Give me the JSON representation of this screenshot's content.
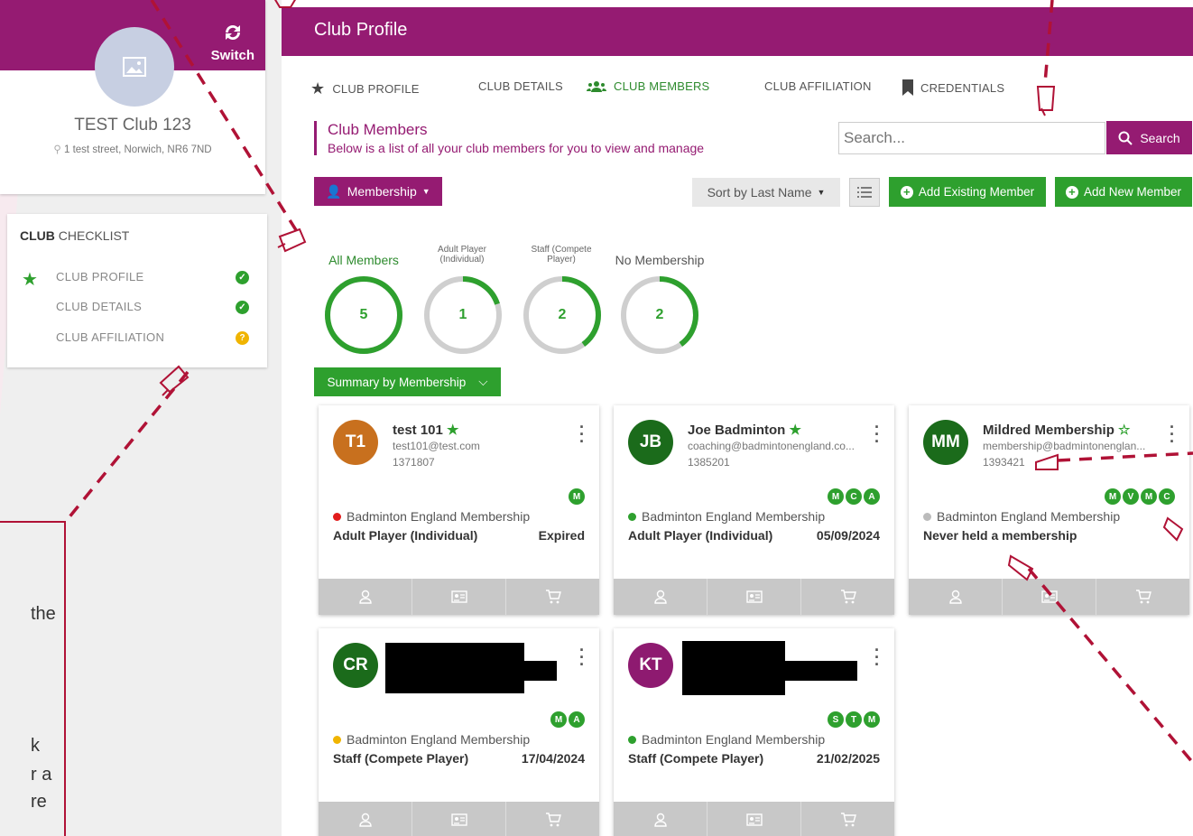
{
  "sidebar": {
    "switch_label": "Switch",
    "club_name": "TEST Club 123",
    "club_address": "1 test street, Norwich, NR6 7ND",
    "checklist_title_bold": "CLUB",
    "checklist_title_rest": "CHECKLIST",
    "checklist_items": [
      {
        "label": "CLUB PROFILE",
        "status": "complete"
      },
      {
        "label": "CLUB DETAILS",
        "status": "complete"
      },
      {
        "label": "CLUB AFFILIATION",
        "status": "pending"
      }
    ],
    "instruction_fragments": [
      "the",
      "k",
      "r a",
      "re"
    ]
  },
  "header": {
    "title": "Club Profile"
  },
  "tabs": [
    {
      "label": "CLUB PROFILE",
      "icon": "star-icon"
    },
    {
      "label": "CLUB DETAILS",
      "icon": ""
    },
    {
      "label": "CLUB MEMBERS",
      "icon": "users-icon",
      "active": true
    },
    {
      "label": "CLUB AFFILIATION",
      "icon": ""
    },
    {
      "label": "CREDENTIALS",
      "icon": "bookmark-icon"
    }
  ],
  "section": {
    "title": "Club Members",
    "subtitle": "Below is a list of all your club members for you to view and manage"
  },
  "search": {
    "placeholder": "Search...",
    "button_label": "Search"
  },
  "toolbar": {
    "membership_label": "Membership",
    "sort_label": "Sort by Last Name",
    "add_existing_label": "Add Existing Member",
    "add_new_label": "Add New Member"
  },
  "summary_rings": [
    {
      "label": "All Members",
      "count": "5",
      "fraction": 1.0
    },
    {
      "label": "Adult Player (Individual)",
      "count": "1",
      "fraction": 0.2
    },
    {
      "label": "Staff (Compete Player)",
      "count": "2",
      "fraction": 0.4
    },
    {
      "label": "No Membership",
      "count": "2",
      "fraction": 0.4
    }
  ],
  "summary_button": "Summary by Membership",
  "members": [
    {
      "initials": "T1",
      "name": "test 101",
      "star": "★",
      "email": "test101@test.com",
      "id": "1371807",
      "badges": [
        "M"
      ],
      "membership_type": "Badminton England Membership",
      "status_color": "#e21c1c",
      "category": "Adult Player (Individual)",
      "expiry": "Expired",
      "avatar_color": "#c8701e"
    },
    {
      "initials": "JB",
      "name": "Joe Badminton",
      "star": "★",
      "email": "coaching@badmintonengland.co...",
      "id": "1385201",
      "badges": [
        "M",
        "C",
        "A"
      ],
      "membership_type": "Badminton England Membership",
      "status_color": "#2ea02e",
      "category": "Adult Player (Individual)",
      "expiry": "05/09/2024",
      "avatar_color": "#1b6b1b"
    },
    {
      "initials": "MM",
      "name": "Mildred Membership",
      "star": "☆",
      "email": "membership@badmintonenglan...",
      "id": "1393421",
      "badges": [
        "M",
        "V",
        "M",
        "C"
      ],
      "membership_type": "Badminton England Membership",
      "status_color": "#bbbbbb",
      "category": "Never held a membership",
      "expiry": "",
      "avatar_color": "#1b6b1b"
    },
    {
      "initials": "CR",
      "name": "",
      "star": "★",
      "email": "",
      "id": "",
      "badges": [
        "M",
        "A"
      ],
      "membership_type": "Badminton England Membership",
      "status_color": "#f0b400",
      "category": "Staff (Compete Player)",
      "expiry": "17/04/2024",
      "avatar_color": "#1b6b1b"
    },
    {
      "initials": "KT",
      "name": "",
      "star": "★",
      "email": "",
      "id": "",
      "badges": [
        "S",
        "T",
        "M"
      ],
      "membership_type": "Badminton England Membership",
      "status_color": "#2ea02e",
      "category": "Staff (Compete Player)",
      "expiry": "21/02/2025",
      "avatar_color": "#8e1a70"
    }
  ],
  "colors": {
    "brand": "#951b72",
    "accent_green": "#2ea02e",
    "annotation_red": "#b01236"
  }
}
